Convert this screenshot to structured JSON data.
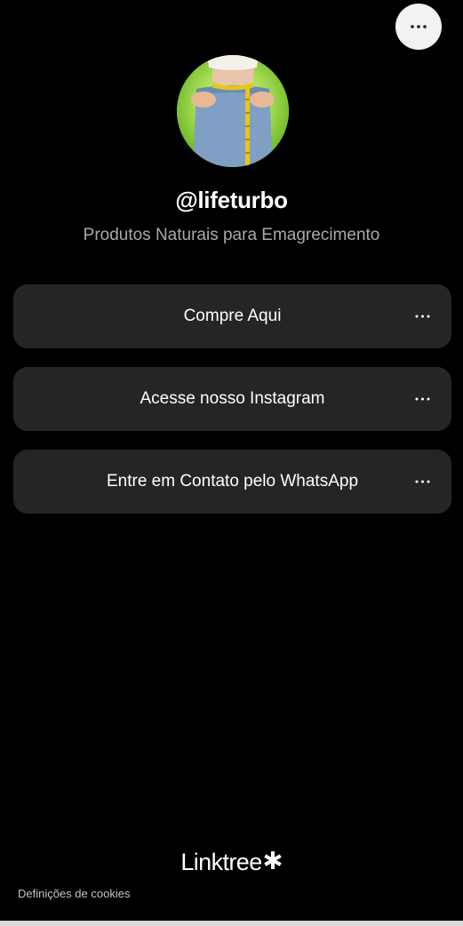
{
  "header": {
    "menu_icon": "ellipsis-icon"
  },
  "profile": {
    "username": "@lifeturbo",
    "bio": "Produtos Naturais para Emagrecimento"
  },
  "links": [
    {
      "label": "Compre Aqui"
    },
    {
      "label": "Acesse nosso Instagram"
    },
    {
      "label": "Entre em Contato pelo WhatsApp"
    }
  ],
  "footer": {
    "logo_text": "Linktree",
    "cookies_label": "Definições de cookies"
  },
  "colors": {
    "background": "#000000",
    "card": "#252525",
    "bio_text": "#a9a9a9"
  }
}
